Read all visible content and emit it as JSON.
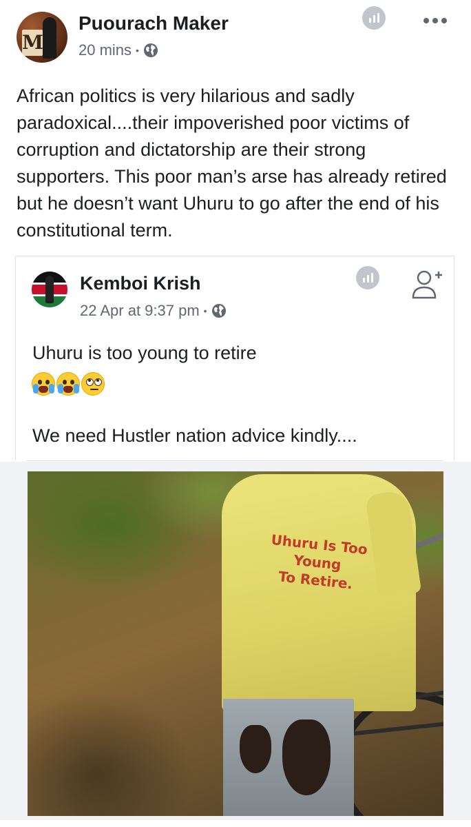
{
  "post": {
    "author": "Puourach Maker",
    "time": "20 mins",
    "separator": "•",
    "text": "African politics is very hilarious and sadly paradoxical....their impoverished poor victims of corruption and dictatorship are their strong supporters. This poor man’s arse has already retired but he doesn’t want Uhuru to go after the end of his constitutional term."
  },
  "shared": {
    "author": "Kemboi Krish",
    "time": "22 Apr at 9:37 pm",
    "separator": "•",
    "line1": "Uhuru is too young to retire",
    "line2": "We need Hustler nation advice kindly....",
    "emojis": [
      "loudly-crying-face",
      "loudly-crying-face",
      "face-with-rolling-eyes"
    ]
  },
  "photo": {
    "shirt_text": [
      "Uhuru Is Too",
      "Young",
      "To Retire."
    ]
  },
  "icons": {
    "audience": "globe-icon",
    "insights": "insights-icon",
    "menu": "more-options-icon",
    "follow": "add-friend-icon"
  },
  "colors": {
    "text": "#1c1e21",
    "meta": "#606770",
    "icon_gray": "#c2c6cc",
    "border": "#dddfe2",
    "shirt_text": "#c23a2a"
  }
}
